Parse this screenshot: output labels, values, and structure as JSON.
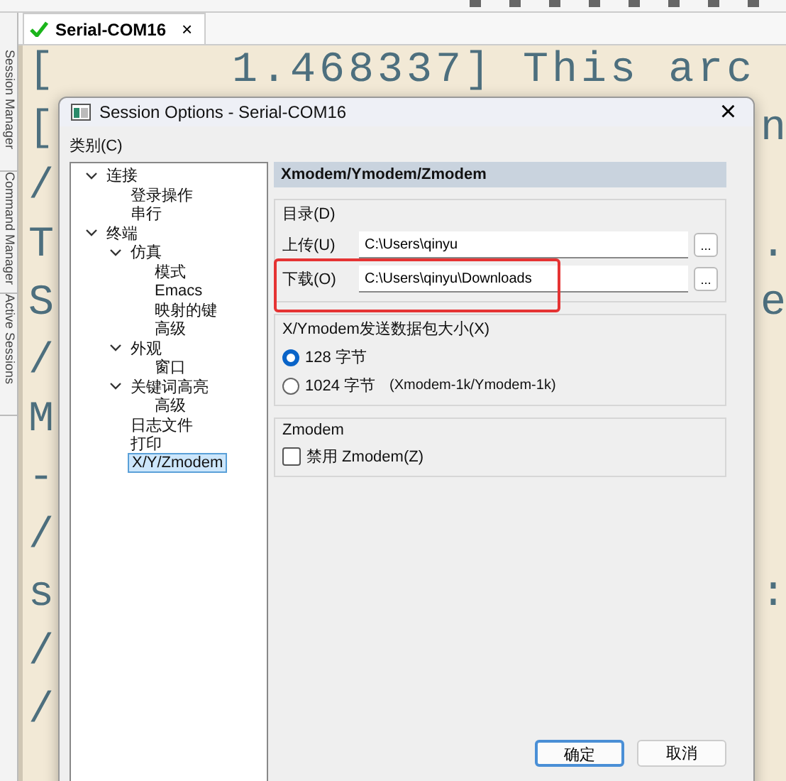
{
  "side_tabs": [
    "Session Manager",
    "Command Manager",
    "Active Sessions"
  ],
  "tabs": [
    {
      "label": "Serial-COM16",
      "selected": true,
      "connected": true,
      "close": "×"
    }
  ],
  "terminal": {
    "lines": [
      {
        "left": "[      1.468337] This arc"
      },
      {
        "left": "[",
        "right": "n"
      },
      {
        "left": "/"
      },
      {
        "left": "T",
        "right": "."
      },
      {
        "left": "S",
        "right": "e"
      },
      {
        "left": "/"
      },
      {
        "left": "M"
      },
      {
        "left": "-"
      },
      {
        "left": "/"
      },
      {
        "left": "s",
        "right": ":"
      },
      {
        "left": "/"
      },
      {
        "left": "/"
      }
    ]
  },
  "dialog": {
    "title": "Session Options - Serial-COM16",
    "close": "×",
    "category_label": "类别(C)",
    "tree": [
      {
        "label": "连接",
        "expanded": true,
        "selected": false,
        "children": [
          {
            "label": "登录操作",
            "selected": false
          },
          {
            "label": "串行",
            "selected": false
          }
        ]
      },
      {
        "label": "终端",
        "expanded": true,
        "selected": false,
        "children": [
          {
            "label": "仿真",
            "expanded": true,
            "selected": false,
            "children": [
              {
                "label": "模式",
                "selected": false
              },
              {
                "label": "Emacs",
                "selected": false
              },
              {
                "label": "映射的键",
                "selected": false
              },
              {
                "label": "高级",
                "selected": false
              }
            ]
          },
          {
            "label": "外观",
            "expanded": true,
            "selected": false,
            "children": [
              {
                "label": "窗口",
                "selected": false
              }
            ]
          },
          {
            "label": "关键词高亮",
            "expanded": true,
            "selected": false,
            "children": [
              {
                "label": "高级",
                "selected": false
              }
            ]
          },
          {
            "label": "日志文件",
            "selected": false
          },
          {
            "label": "打印",
            "selected": false
          },
          {
            "label": "X/Y/Zmodem",
            "selected": true
          }
        ]
      }
    ],
    "panel_title": "Xmodem/Ymodem/Zmodem",
    "directory": {
      "title": "目录(D)",
      "rows": [
        {
          "label": "上传(U)",
          "value": "C:\\Users\\qinyu",
          "browse": "...",
          "highlighted": false
        },
        {
          "label": "下载(O)",
          "value": "C:\\Users\\qinyu\\Downloads",
          "browse": "...",
          "highlighted": true
        }
      ]
    },
    "packet_size": {
      "title": "X/Ymodem发送数据包大小(X)",
      "options": [
        {
          "label": "128 字节",
          "selected": true
        },
        {
          "label": "1024 字节",
          "note": "(Xmodem-1k/Ymodem-1k)",
          "selected": false
        }
      ]
    },
    "zmodem": {
      "title": "Zmodem",
      "checkbox": {
        "label": "禁用 Zmodem(Z)",
        "checked": false
      }
    },
    "buttons": [
      {
        "label": "确定",
        "default": true
      },
      {
        "label": "取消",
        "default": false
      }
    ]
  }
}
